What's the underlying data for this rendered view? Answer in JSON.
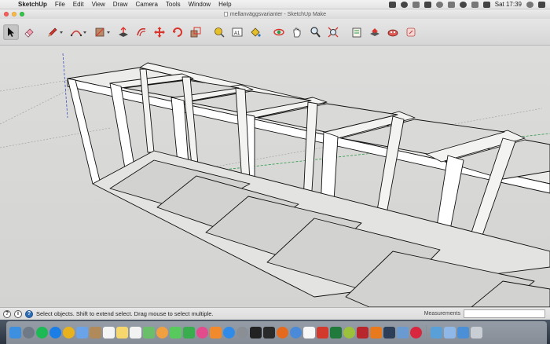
{
  "menubar": {
    "apple_symbol": "",
    "items": [
      "SketchUp",
      "File",
      "Edit",
      "View",
      "Draw",
      "Camera",
      "Tools",
      "Window",
      "Help"
    ],
    "clock": "Sat 17:39",
    "tray_icons": [
      "dropbox-icon",
      "cloud-icon",
      "flame-icon",
      "battery-icon",
      "info-icon",
      "bluetooth-icon",
      "wifi-icon",
      "volume-icon",
      "flag-icon",
      "search-icon",
      "list-icon"
    ]
  },
  "window": {
    "title": "mellanväggsvarianter - SketchUp Make"
  },
  "toolbar": {
    "tools": [
      {
        "name": "select-icon",
        "active": true
      },
      {
        "name": "eraser-icon"
      },
      {
        "name": "pencil-icon",
        "dropdown": true
      },
      {
        "name": "arc-icon",
        "dropdown": true
      },
      {
        "name": "rectangle-icon",
        "dropdown": true
      },
      {
        "name": "push-pull-icon"
      },
      {
        "name": "offset-icon"
      },
      {
        "name": "move-icon"
      },
      {
        "name": "rotate-icon"
      },
      {
        "name": "scale-icon"
      },
      {
        "name": "tape-measure-icon"
      },
      {
        "name": "text-icon"
      },
      {
        "name": "paint-bucket-icon"
      },
      {
        "name": "orbit-icon"
      },
      {
        "name": "pan-icon"
      },
      {
        "name": "zoom-icon"
      },
      {
        "name": "zoom-extents-icon"
      },
      {
        "name": "warehouse-icon"
      },
      {
        "name": "extension-warehouse-icon"
      },
      {
        "name": "components-icon"
      },
      {
        "name": "send-to-layout-icon"
      }
    ],
    "text_tool_label": "A1"
  },
  "statusbar": {
    "message": "Select objects. Shift to extend select. Drag mouse to select multiple.",
    "measurements_label": "Measurements",
    "measurements_value": ""
  },
  "dock": {
    "apps": [
      {
        "name": "finder-icon",
        "color": "#3d8fe0"
      },
      {
        "name": "launchpad-icon",
        "color": "#6f7a86",
        "round": true
      },
      {
        "name": "spotify-icon",
        "color": "#1db954",
        "round": true
      },
      {
        "name": "safari-icon",
        "color": "#1a7ee6",
        "round": true
      },
      {
        "name": "chrome-icon",
        "color": "#e8b21e",
        "round": true
      },
      {
        "name": "mail-icon",
        "color": "#6aa3e8"
      },
      {
        "name": "contacts-icon",
        "color": "#b08a5a"
      },
      {
        "name": "calendar-icon",
        "color": "#f4f4f4"
      },
      {
        "name": "notes-icon",
        "color": "#f5d76e"
      },
      {
        "name": "reminders-icon",
        "color": "#f2f2f2"
      },
      {
        "name": "maps-icon",
        "color": "#6cbf6a"
      },
      {
        "name": "photos-icon",
        "color": "#f0a040",
        "round": true
      },
      {
        "name": "messages-icon",
        "color": "#58c95c"
      },
      {
        "name": "facetime-icon",
        "color": "#3aad4f"
      },
      {
        "name": "itunes-icon",
        "color": "#e24b8c",
        "round": true
      },
      {
        "name": "ibooks-icon",
        "color": "#f08a2c"
      },
      {
        "name": "app-store-icon",
        "color": "#2f8ae8",
        "round": true
      },
      {
        "name": "system-preferences-icon",
        "color": "#8a8f96",
        "round": true
      },
      {
        "name": "terminal-icon",
        "color": "#222"
      },
      {
        "name": "activity-monitor-icon",
        "color": "#2a2a2a"
      },
      {
        "name": "firefox-icon",
        "color": "#e66a1e",
        "round": true
      },
      {
        "name": "info-app-icon",
        "color": "#4a8ad8",
        "round": true
      },
      {
        "name": "textedit-icon",
        "color": "#f7f7f7"
      },
      {
        "name": "sketchup-icon",
        "color": "#d23a2e"
      },
      {
        "name": "excel-icon",
        "color": "#1f7a3c"
      },
      {
        "name": "android-icon",
        "color": "#9cc23c",
        "round": true
      },
      {
        "name": "filezilla-icon",
        "color": "#b7272c"
      },
      {
        "name": "vlc-icon",
        "color": "#e8791c"
      },
      {
        "name": "steam-icon",
        "color": "#2c3e58"
      },
      {
        "name": "coda-icon",
        "color": "#6a9ad0"
      },
      {
        "name": "lips-app-icon",
        "color": "#d7263d",
        "round": true
      },
      {
        "name": "media-icon",
        "color": "#5aa0d8"
      },
      {
        "name": "documents-folder-icon",
        "color": "#8fb8e8"
      },
      {
        "name": "downloads-folder-icon",
        "color": "#4b8fd6"
      },
      {
        "name": "trash-icon",
        "color": "#c9ced5"
      }
    ],
    "divider_before": 31
  }
}
